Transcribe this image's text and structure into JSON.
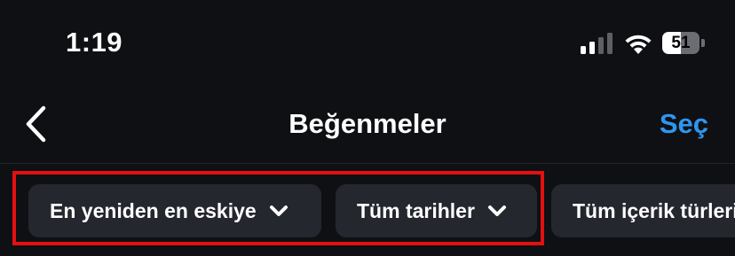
{
  "status_bar": {
    "time": "1:19",
    "battery_level": "51",
    "battery_fraction": 0.51,
    "signal_bars_active": 2,
    "signal_bars_total": 4
  },
  "nav": {
    "title": "Beğenmeler",
    "back_icon": "chevron-left-icon",
    "select_label": "Seç"
  },
  "filters": [
    {
      "label": "En yeniden en eskiye",
      "icon": "chevron-down-icon"
    },
    {
      "label": "Tüm tarihler",
      "icon": "chevron-down-icon"
    },
    {
      "label": "Tüm içerik türleri",
      "icon": "chevron-down-icon"
    }
  ],
  "colors": {
    "background": "#0e1014",
    "chip": "#24272e",
    "accent": "#2e95f0",
    "highlight": "#e41010"
  }
}
